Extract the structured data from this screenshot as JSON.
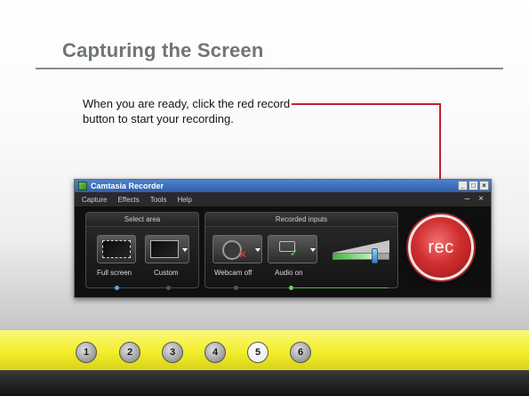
{
  "slide": {
    "title": "Capturing the Screen",
    "instruction": "When you are ready, click the red record button to start your recording."
  },
  "recorder": {
    "window_title": "Camtasia Recorder",
    "menu": [
      "Capture",
      "Effects",
      "Tools",
      "Help"
    ],
    "menu_controls": {
      "minimize": "–",
      "close": "×"
    },
    "window_buttons": {
      "minimize": "_",
      "maximize": "□",
      "close": "×"
    },
    "select_area": {
      "header": "Select area",
      "full_screen_label": "Full screen",
      "custom_label": "Custom"
    },
    "recorded_inputs": {
      "header": "Recorded inputs",
      "webcam_label": "Webcam off",
      "audio_label": "Audio on",
      "audio_level": 0.72
    },
    "rec_label": "rec"
  },
  "navigation": {
    "pages": [
      "1",
      "2",
      "3",
      "4",
      "5",
      "6"
    ],
    "current": "5"
  }
}
